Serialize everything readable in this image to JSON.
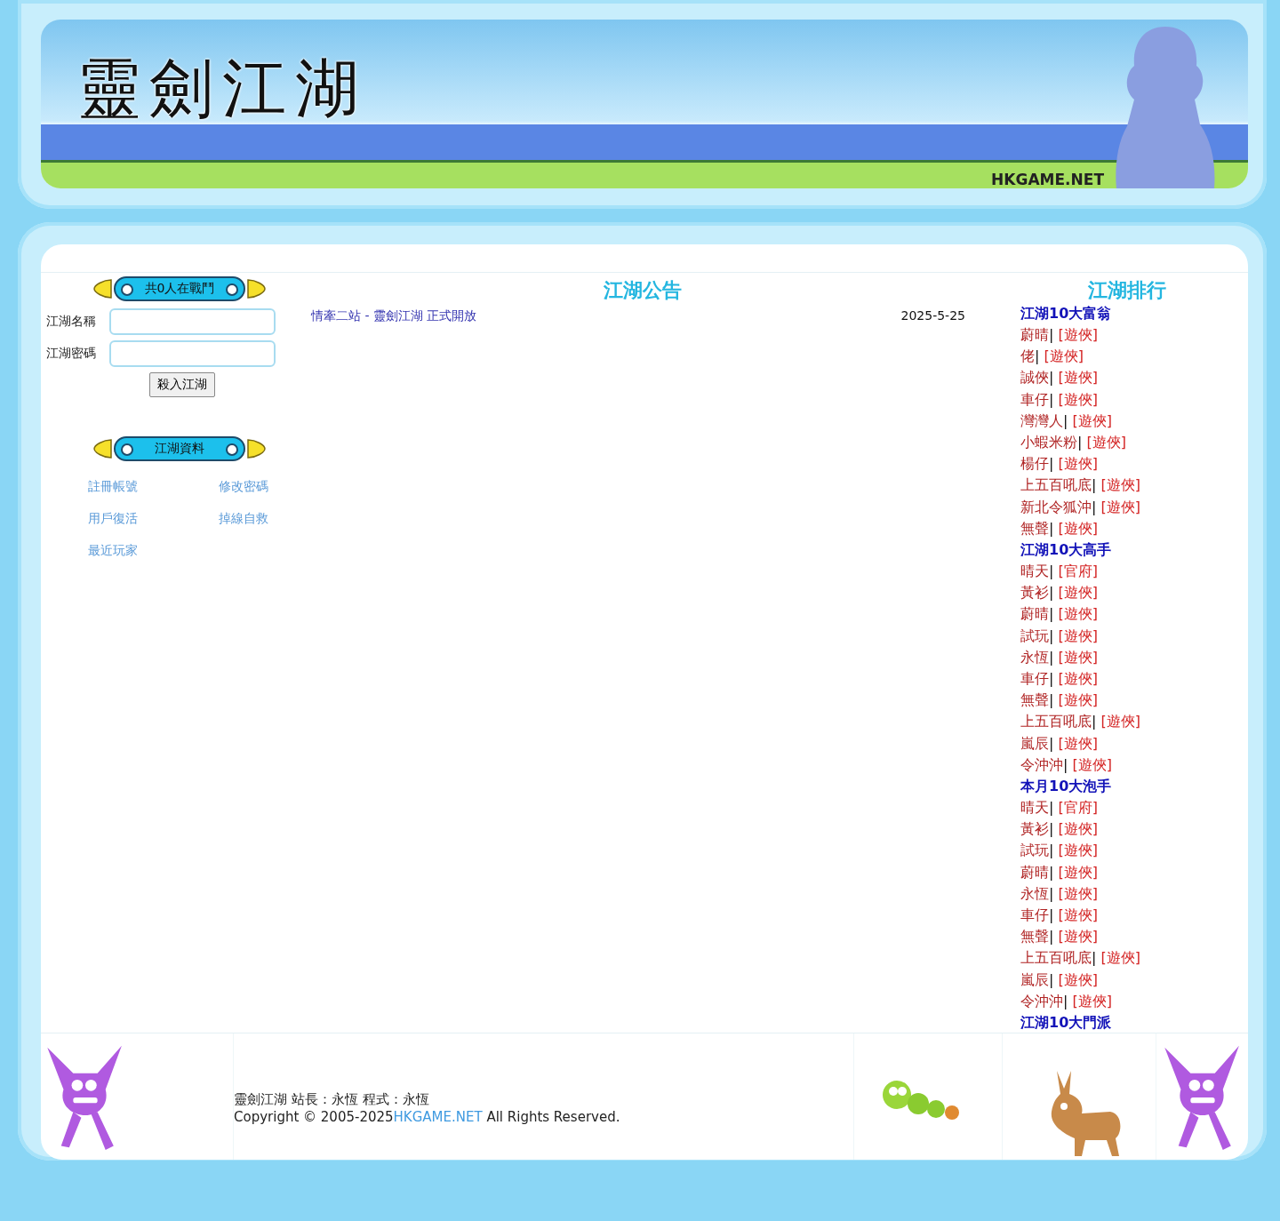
{
  "banner": {
    "title": "靈劍江湖",
    "watermark": "HKGAME.NET"
  },
  "login": {
    "banner": "共0人在戰鬥",
    "fields": [
      {
        "label": "江湖名稱"
      },
      {
        "label": "江湖密碼"
      }
    ],
    "submit": "殺入江湖"
  },
  "info": {
    "banner": "江湖資料",
    "links": [
      "註冊帳號",
      "修改密碼",
      "用戶復活",
      "掉線自救",
      "最近玩家"
    ]
  },
  "notices": {
    "title": "江湖公告",
    "items": [
      {
        "title": "情牽二站 - 靈劍江湖 正式開放",
        "date": "2025-5-25"
      }
    ]
  },
  "ranking": {
    "title": "江湖排行",
    "sections": [
      {
        "title": "江湖10大富翁",
        "entries": [
          {
            "name": "蔚晴",
            "separator": "|",
            "faction": "[遊俠]"
          },
          {
            "name": "佬",
            "separator": "|",
            "faction": "[遊俠]"
          },
          {
            "name": "誠俠",
            "separator": "|",
            "faction": "[遊俠]"
          },
          {
            "name": "車仔",
            "separator": "|",
            "faction": "[遊俠]"
          },
          {
            "name": "灣灣人",
            "separator": "|",
            "faction": "[遊俠]"
          },
          {
            "name": "小蝦米粉",
            "separator": "|",
            "faction": "[遊俠]"
          },
          {
            "name": "楊仔",
            "separator": "|",
            "faction": "[遊俠]"
          },
          {
            "name": "上五百吼底",
            "separator": "|",
            "faction": "[遊俠]"
          },
          {
            "name": "新北令狐沖",
            "separator": "|",
            "faction": "[遊俠]"
          },
          {
            "name": "無聲",
            "separator": "|",
            "faction": "[遊俠]"
          }
        ]
      },
      {
        "title": "江湖10大高手",
        "entries": [
          {
            "name": "晴天",
            "separator": "|",
            "faction": "[官府]"
          },
          {
            "name": "黃衫",
            "separator": "|",
            "faction": "[遊俠]"
          },
          {
            "name": "蔚晴",
            "separator": "|",
            "faction": "[遊俠]"
          },
          {
            "name": "試玩",
            "separator": "|",
            "faction": "[遊俠]"
          },
          {
            "name": "永恆",
            "separator": "|",
            "faction": "[遊俠]"
          },
          {
            "name": "車仔",
            "separator": "|",
            "faction": "[遊俠]"
          },
          {
            "name": "無聲",
            "separator": "|",
            "faction": "[遊俠]"
          },
          {
            "name": "上五百吼底",
            "separator": "|",
            "faction": "[遊俠]"
          },
          {
            "name": "嵐辰",
            "separator": "|",
            "faction": "[遊俠]"
          },
          {
            "name": "令沖沖",
            "separator": "|",
            "faction": "[遊俠]"
          }
        ]
      },
      {
        "title": "本月10大泡手",
        "entries": [
          {
            "name": "晴天",
            "separator": "|",
            "faction": "[官府]"
          },
          {
            "name": "黃衫",
            "separator": "|",
            "faction": "[遊俠]"
          },
          {
            "name": "試玩",
            "separator": "|",
            "faction": "[遊俠]"
          },
          {
            "name": "蔚晴",
            "separator": "|",
            "faction": "[遊俠]"
          },
          {
            "name": "永恆",
            "separator": "|",
            "faction": "[遊俠]"
          },
          {
            "name": "車仔",
            "separator": "|",
            "faction": "[遊俠]"
          },
          {
            "name": "無聲",
            "separator": "|",
            "faction": "[遊俠]"
          },
          {
            "name": "上五百吼底",
            "separator": "|",
            "faction": "[遊俠]"
          },
          {
            "name": "嵐辰",
            "separator": "|",
            "faction": "[遊俠]"
          },
          {
            "name": "令沖沖",
            "separator": "|",
            "faction": "[遊俠]"
          }
        ]
      },
      {
        "title": "江湖10大門派"
      }
    ]
  },
  "footer": {
    "credits": "靈劍江湖 站長：永恆 程式：永恆",
    "copyright": "Copyright © 2005-2025",
    "link": "HKGAME.NET",
    "rights": "All Rights Reserved."
  }
}
